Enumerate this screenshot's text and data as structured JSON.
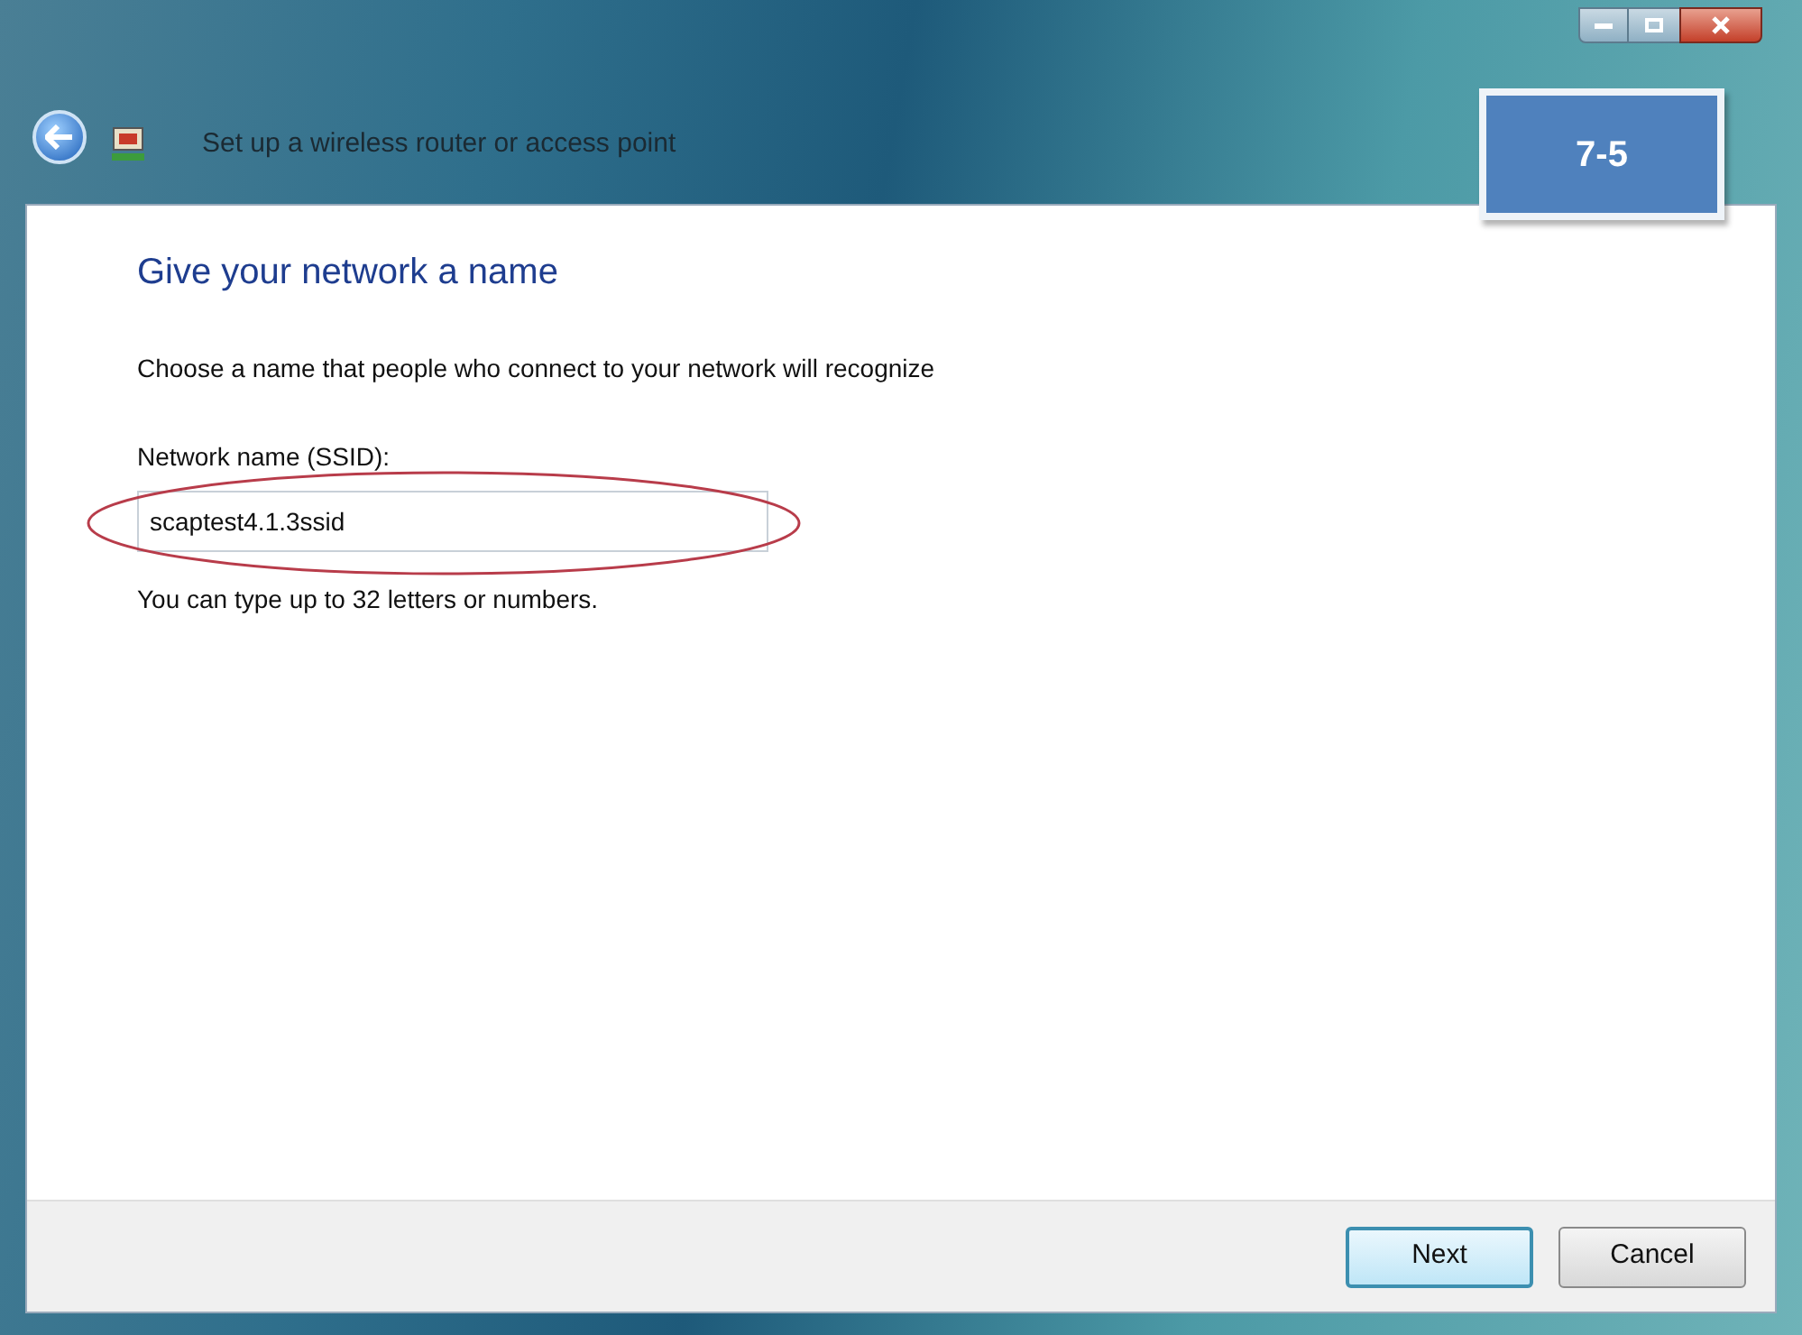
{
  "window": {
    "title": "Set up a wireless router or access point"
  },
  "badge": "7-5",
  "heading": "Give your network a name",
  "instruction": "Choose a name that people who connect to your network will recognize",
  "field": {
    "label": "Network name (SSID):",
    "value": "scaptest4.1.3ssid",
    "annotated": true
  },
  "hint": "You can type up to 32 letters or numbers.",
  "buttons": [
    {
      "label": "Next",
      "default": true
    },
    {
      "label": "Cancel",
      "default": false
    }
  ]
}
